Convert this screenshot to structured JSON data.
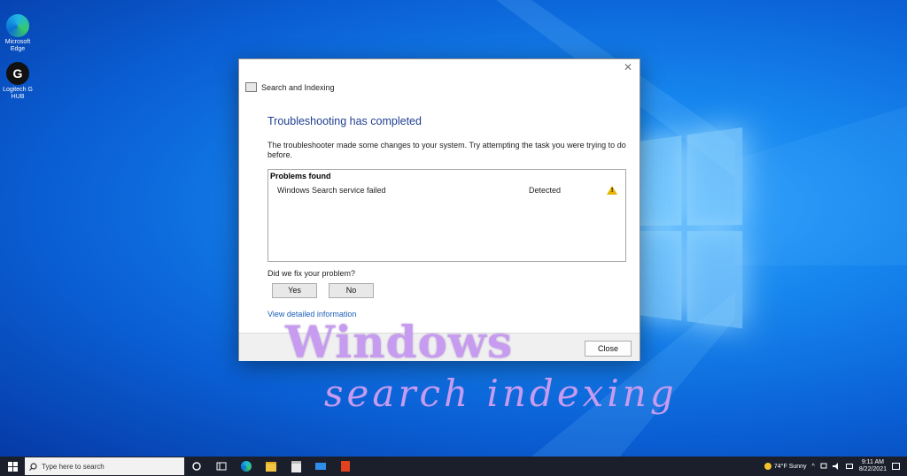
{
  "desktop": {
    "icons": [
      {
        "name": "edge",
        "label": "Microsoft Edge"
      },
      {
        "name": "logitech",
        "label": "Logitech G HUB"
      }
    ]
  },
  "dialog": {
    "window_title": "Search and Indexing",
    "close_glyph": "✕",
    "heading": "Troubleshooting has completed",
    "description": "The troubleshooter made some changes to your system. Try attempting the task you were trying to do before.",
    "problems_header": "Problems found",
    "problems": [
      {
        "name": "Windows Search service failed",
        "status": "Detected",
        "icon": "warning-icon"
      }
    ],
    "question": "Did we fix your problem?",
    "yes_label": "Yes",
    "no_label": "No",
    "detail_link": "View detailed information",
    "close_label": "Close"
  },
  "overlay": {
    "title": "Windows",
    "subtitle": "search indexing"
  },
  "taskbar": {
    "search_placeholder": "Type here to search",
    "weather": "74°F  Sunny",
    "time": "9:11 AM",
    "date": "8/22/2021"
  },
  "colors": {
    "accent_heading": "#1f3f8f",
    "link": "#1c5fb8",
    "overlay": "#c79cf0",
    "warning": "#e8b400"
  }
}
